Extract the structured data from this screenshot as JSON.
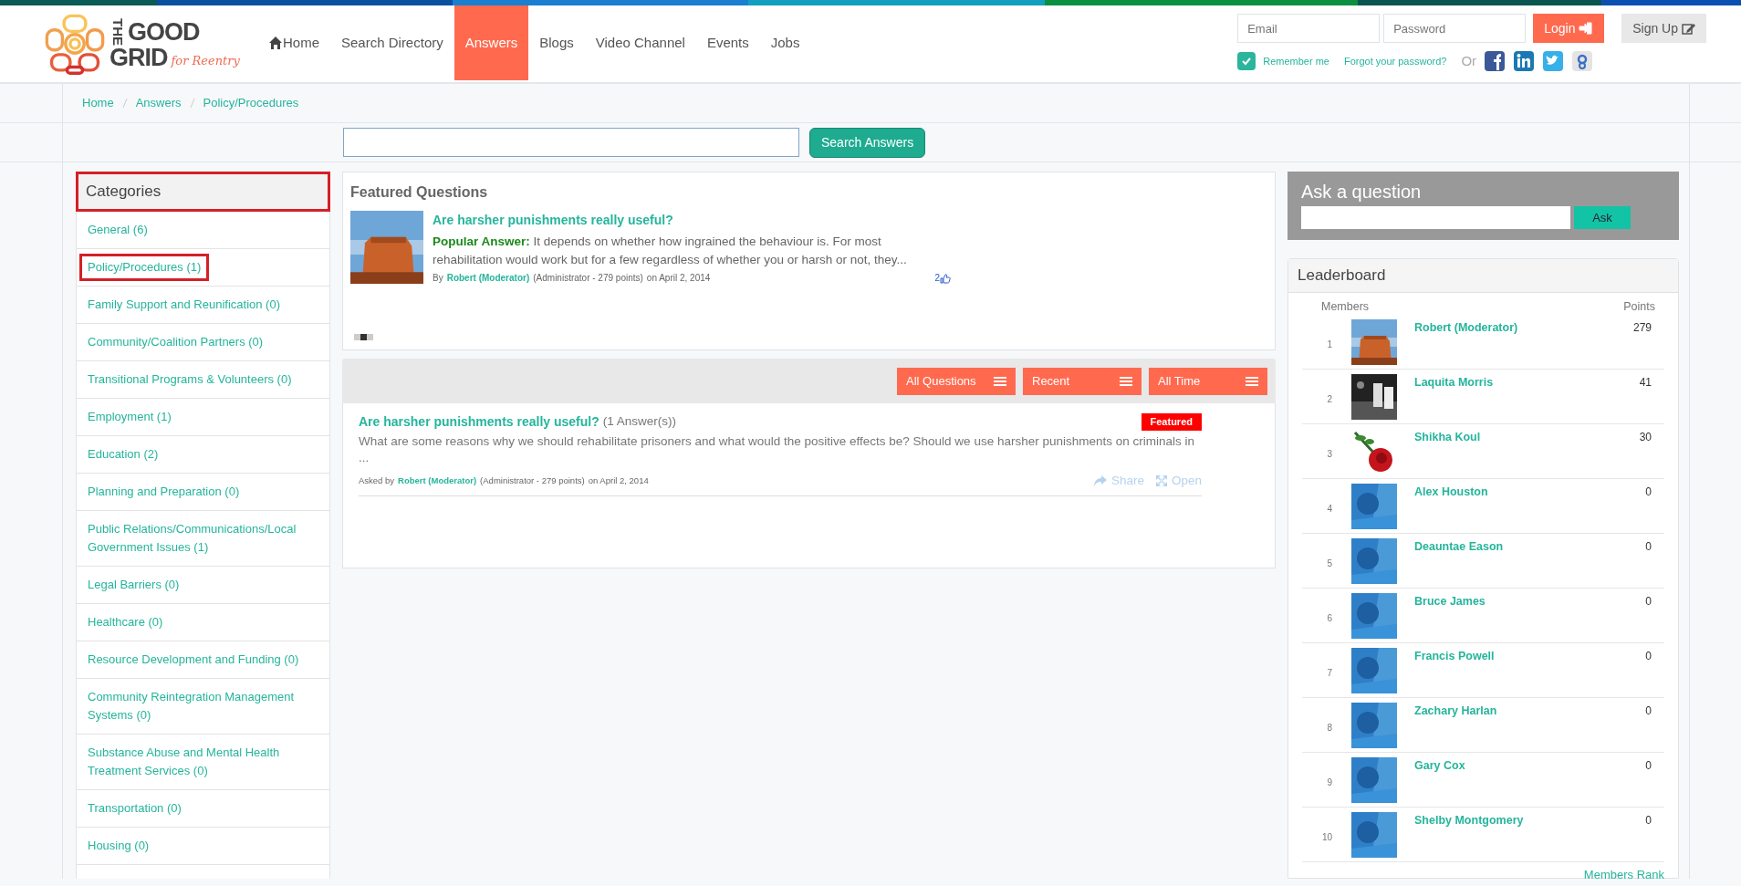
{
  "logo": {
    "word_the": "THE",
    "word_good": "GOOD",
    "word_grid": "GRID",
    "tagline": "for Reentry"
  },
  "nav": [
    {
      "label": "Home",
      "kind": "home",
      "selected": false
    },
    {
      "label": "Search Directory",
      "selected": false
    },
    {
      "label": "Answers",
      "selected": true
    },
    {
      "label": "Blogs",
      "selected": false
    },
    {
      "label": "Video Channel",
      "selected": false
    },
    {
      "label": "Events",
      "selected": false
    },
    {
      "label": "Jobs",
      "selected": false
    }
  ],
  "login": {
    "email_placeholder": "Email",
    "password_placeholder": "Password",
    "login_button": "Login",
    "signup_button": "Sign Up",
    "remember_label": "Remember me",
    "remember_checked": true,
    "forgot_link": "Forgot your password?",
    "or_text": "Or"
  },
  "breadcrumb": [
    "Home",
    "Answers",
    "Policy/Procedures"
  ],
  "search": {
    "button": "Search Answers"
  },
  "categories": {
    "title": "Categories",
    "title_highlighted": true,
    "items": [
      {
        "label": "General (6)",
        "highlighted": false
      },
      {
        "label": "Policy/Procedures (1)",
        "highlighted": true
      },
      {
        "label": "Family Support and Reunification (0)",
        "highlighted": false
      },
      {
        "label": "Community/Coalition Partners (0)",
        "highlighted": false
      },
      {
        "label": "Transitional Programs & Volunteers (0)",
        "highlighted": false
      },
      {
        "label": "Employment (1)",
        "highlighted": false
      },
      {
        "label": "Education (2)",
        "highlighted": false
      },
      {
        "label": "Planning and Preparation (0)",
        "highlighted": false
      },
      {
        "label": "Public Relations/Communications/Local Government Issues (1)",
        "highlighted": false
      },
      {
        "label": "Legal Barriers (0)",
        "highlighted": false
      },
      {
        "label": "Healthcare (0)",
        "highlighted": false
      },
      {
        "label": "Resource Development and Funding (0)",
        "highlighted": false
      },
      {
        "label": "Community Reintegration Management Systems (0)",
        "highlighted": false
      },
      {
        "label": "Substance Abuse and Mental Health Treatment Services (0)",
        "highlighted": false
      },
      {
        "label": "Transportation (0)",
        "highlighted": false
      },
      {
        "label": "Housing (0)",
        "highlighted": false
      }
    ]
  },
  "featured": {
    "title": "Featured Questions",
    "question": "Are harsher punishments really useful?",
    "answer_label": "Popular Answer:",
    "answer_text": "It depends on whether how ingrained the behaviour is. For most rehabilitation would work but for a few regardless of whether you or harsh or not, they...",
    "by": "By",
    "author": "Robert (Moderator)",
    "role": "(Administrator - 279 points)",
    "date": "on April 2, 2014",
    "likes": "2",
    "indicators": [
      {
        "selected": false
      },
      {
        "selected": true
      },
      {
        "selected": false
      }
    ]
  },
  "filters": [
    "All Questions",
    "Recent",
    "All Time"
  ],
  "questions": [
    {
      "title": "Are harsher punishments really useful?",
      "answers": "(1 Answer(s))",
      "badge": "Featured",
      "excerpt": "What are some reasons why we should rehabilitate prisoners and what would the positive effects be? Should we use harsher punishments on criminals in ...",
      "asked_by": "Asked by",
      "author": "Robert (Moderator)",
      "role": "(Administrator - 279 points)",
      "date": "on April 2, 2014",
      "share": "Share",
      "open": "Open"
    }
  ],
  "ask": {
    "title": "Ask a question",
    "button": "Ask"
  },
  "leaderboard": {
    "title": "Leaderboard",
    "col_members": "Members",
    "col_points": "Points",
    "rows": [
      {
        "rank": "1",
        "name": "Robert (Moderator)",
        "points": "279"
      },
      {
        "rank": "2",
        "name": "Laquita Morris",
        "points": "41"
      },
      {
        "rank": "3",
        "name": "Shikha Koul",
        "points": "30"
      },
      {
        "rank": "4",
        "name": "Alex Houston",
        "points": "0"
      },
      {
        "rank": "5",
        "name": "Deauntae Eason",
        "points": "0"
      },
      {
        "rank": "6",
        "name": "Bruce James",
        "points": "0"
      },
      {
        "rank": "7",
        "name": "Francis Powell",
        "points": "0"
      },
      {
        "rank": "8",
        "name": "Zachary Harlan",
        "points": "0"
      },
      {
        "rank": "9",
        "name": "Gary Cox",
        "points": "0"
      },
      {
        "rank": "10",
        "name": "Shelby Montgomery",
        "points": "0"
      }
    ],
    "footer_link": "Members Rank"
  }
}
